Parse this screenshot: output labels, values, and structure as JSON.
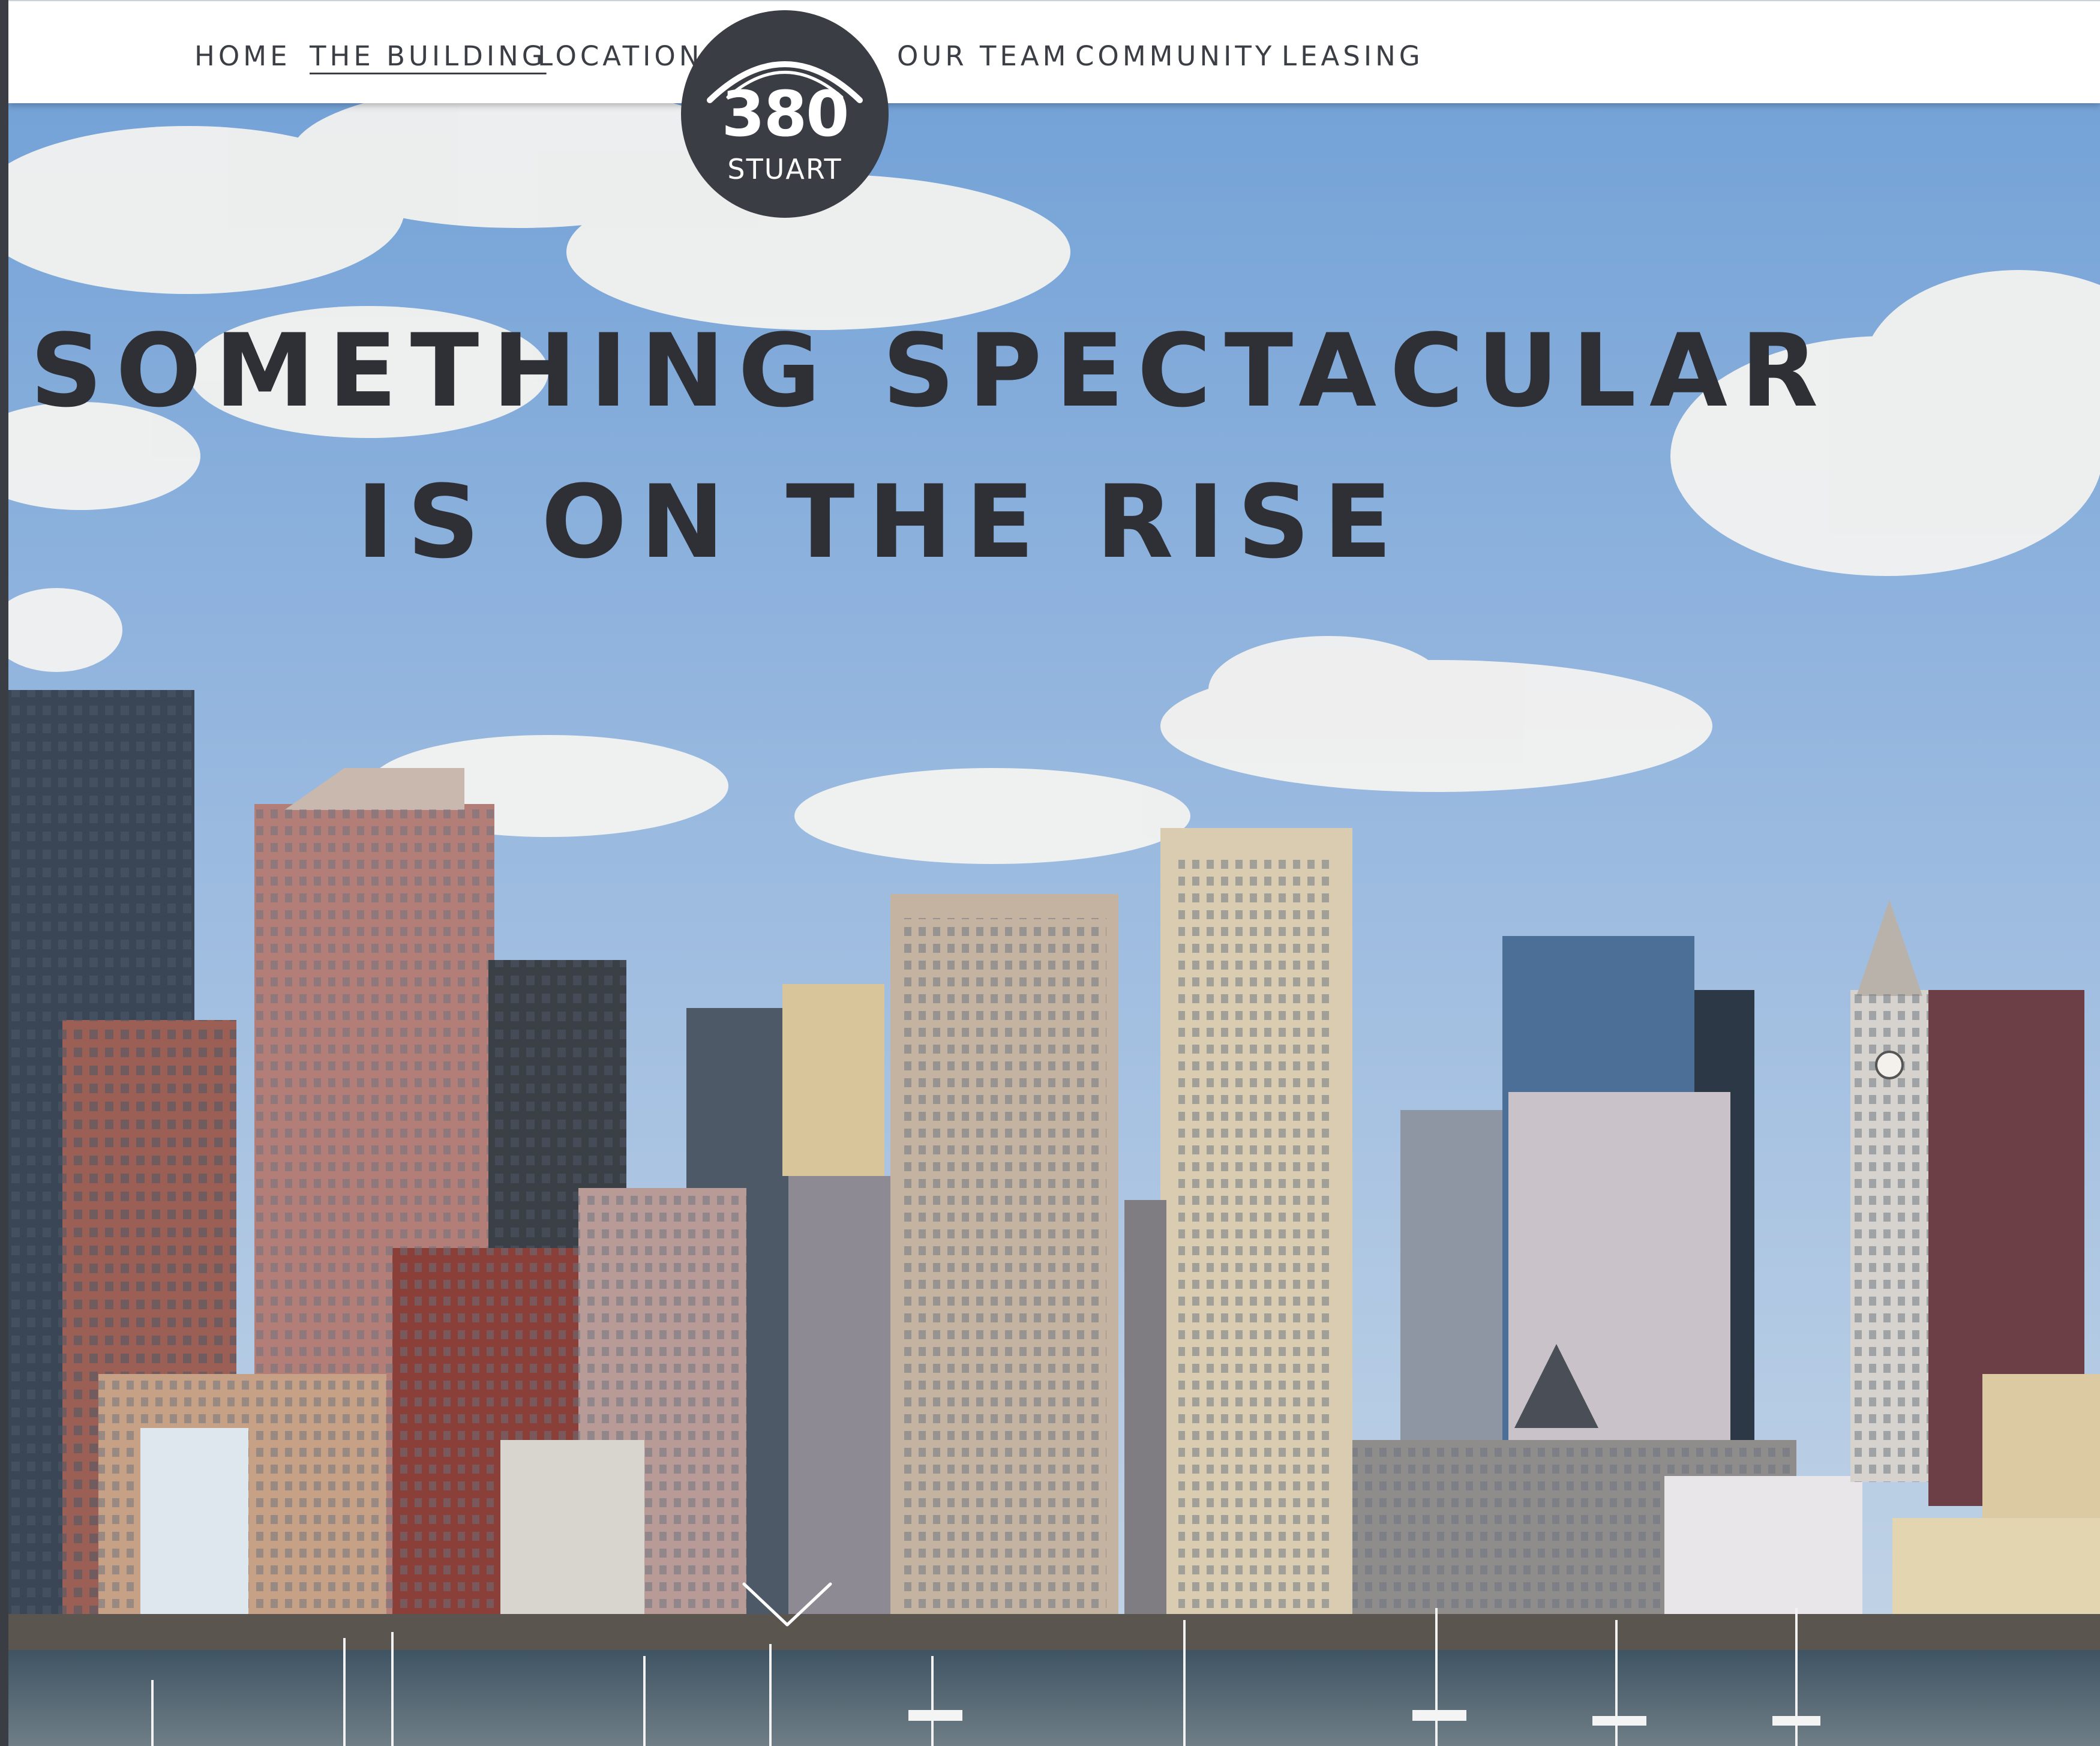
{
  "nav": {
    "items": [
      {
        "label": "HOME",
        "active": false
      },
      {
        "label": "THE BUILDING",
        "active": true
      },
      {
        "label": "LOCATION",
        "active": false
      },
      {
        "label": "OUR TEAM",
        "active": false
      },
      {
        "label": "COMMUNITY",
        "active": false
      },
      {
        "label": "LEASING",
        "active": false
      }
    ]
  },
  "logo": {
    "number": "380",
    "name": "STUART"
  },
  "hero": {
    "headline_line1": "SOMETHING SPECTACULAR",
    "headline_line2": "IS ON THE RISE",
    "image": "city-skyline-harbor-photo"
  },
  "scroll_icon": "chevron-down-icon",
  "colors": {
    "nav_background": "#ffffff",
    "nav_text": "#3b3e45",
    "logo_circle": "#3a3d44",
    "headline": "#2f3035",
    "sky": "#8db0d8"
  }
}
